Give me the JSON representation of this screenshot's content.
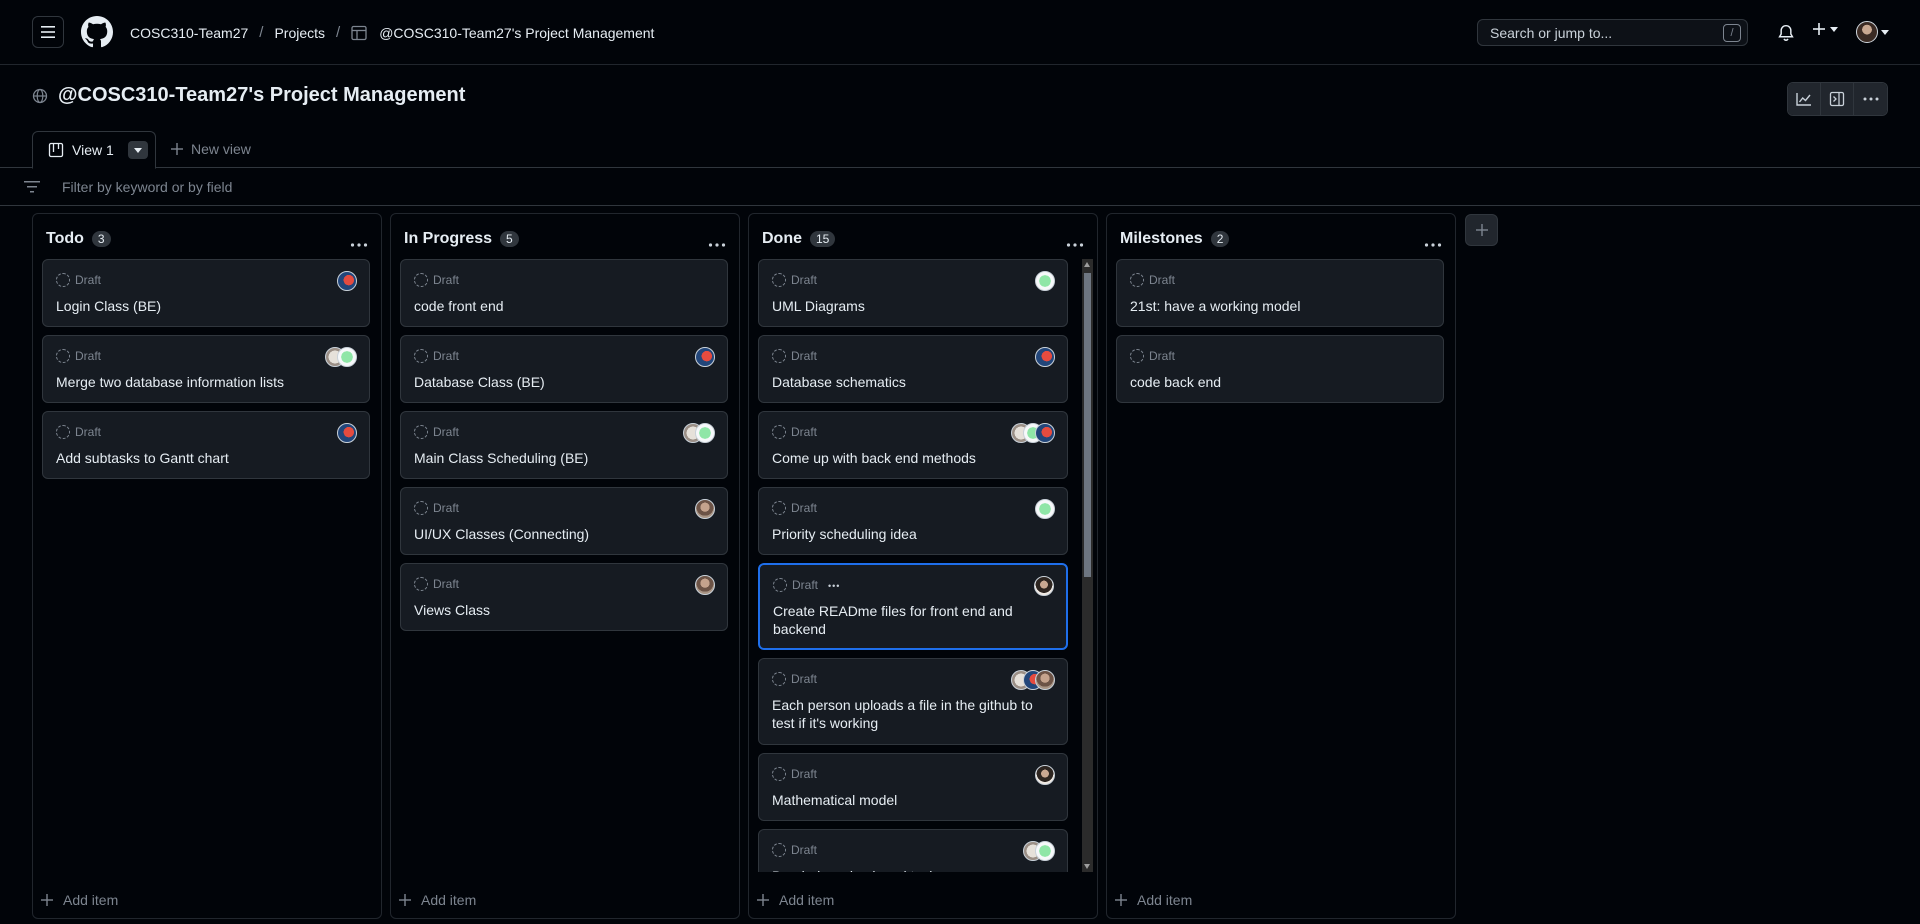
{
  "breadcrumb": {
    "org": "COSC310-Team27",
    "section": "Projects",
    "project": "@COSC310-Team27's Project Management"
  },
  "search": {
    "placeholder": "Search or jump to...",
    "shortcut": "/"
  },
  "project": {
    "title": "@COSC310-Team27's Project Management"
  },
  "tabs": {
    "active": "View 1",
    "new_view": "New view"
  },
  "filter": {
    "placeholder": "Filter by keyword or by field"
  },
  "board": {
    "add_item_label": "Add item",
    "columns": [
      {
        "title": "Todo",
        "count": "3",
        "cards": [
          {
            "status": "Draft",
            "title": "Login Class (BE)",
            "avatars": [
              "red"
            ]
          },
          {
            "status": "Draft",
            "title": "Merge two database information lists",
            "avatars": [
              "green",
              "light"
            ]
          },
          {
            "status": "Draft",
            "title": "Add subtasks to Gantt chart",
            "avatars": [
              "red"
            ]
          }
        ]
      },
      {
        "title": "In Progress",
        "count": "5",
        "cards": [
          {
            "status": "Draft",
            "title": "code front end",
            "avatars": []
          },
          {
            "status": "Draft",
            "title": "Database Class (BE)",
            "avatars": [
              "red"
            ]
          },
          {
            "status": "Draft",
            "title": "Main Class Scheduling (BE)",
            "avatars": [
              "green",
              "light"
            ]
          },
          {
            "status": "Draft",
            "title": "UI/UX Classes (Connecting)",
            "avatars": [
              "photo"
            ]
          },
          {
            "status": "Draft",
            "title": "Views Class",
            "avatars": [
              "photo"
            ]
          }
        ]
      },
      {
        "title": "Done",
        "count": "15",
        "cards": [
          {
            "status": "Draft",
            "title": "UML Diagrams",
            "avatars": [
              "green"
            ]
          },
          {
            "status": "Draft",
            "title": "Database schematics",
            "avatars": [
              "red"
            ]
          },
          {
            "status": "Draft",
            "title": "Come up with back end methods",
            "avatars": [
              "red",
              "green",
              "light"
            ]
          },
          {
            "status": "Draft",
            "title": "Priority scheduling idea",
            "avatars": [
              "green"
            ]
          },
          {
            "status": "Draft",
            "title": "Create READme files for front end and backend",
            "avatars": [
              "face"
            ]
          },
          {
            "status": "Draft",
            "title": "Each person uploads a file in the github to test if it's working",
            "avatars": [
              "photo",
              "red",
              "light"
            ]
          },
          {
            "status": "Draft",
            "title": "Mathematical model",
            "avatars": [
              "face"
            ]
          },
          {
            "status": "Draft",
            "title": "Break down back end tasks",
            "avatars": [
              "green",
              "light"
            ]
          }
        ]
      },
      {
        "title": "Milestones",
        "count": "2",
        "cards": [
          {
            "status": "Draft",
            "title": "21st: have a working model",
            "avatars": []
          },
          {
            "status": "Draft",
            "title": "code back end",
            "avatars": []
          }
        ]
      }
    ]
  }
}
